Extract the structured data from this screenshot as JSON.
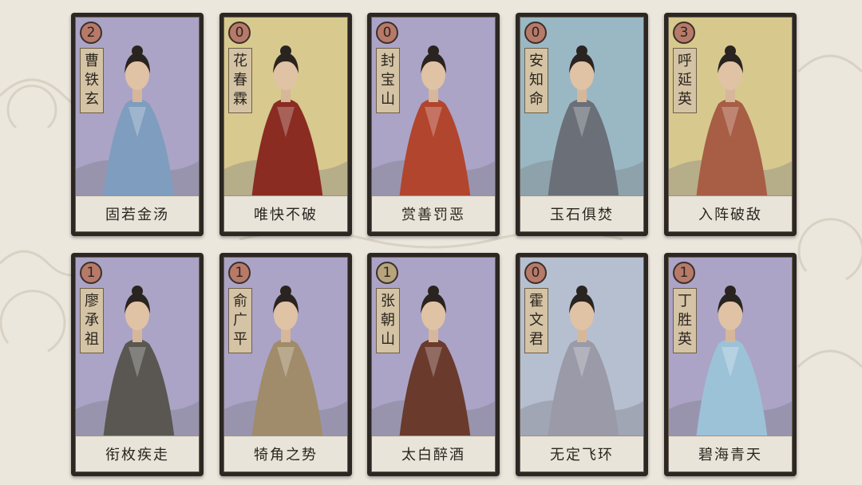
{
  "colors": {
    "background": "#ece7dd",
    "card_frame": "#2c2723",
    "cost_red": "#b77a69",
    "cost_gold": "#b7a47c",
    "name_panel": "#d4c4a5",
    "skill_bar": "#e9e4da"
  },
  "cards": [
    {
      "cost": "2",
      "name": "曹铁玄",
      "skill": "固若金汤",
      "cost_color": "#b77a69",
      "bg": "#aba4c6",
      "robe": "#7f9dbe"
    },
    {
      "cost": "0",
      "name": "花春霖",
      "skill": "唯快不破",
      "cost_color": "#b77a69",
      "bg": "#d8c98e",
      "robe": "#8a2c22"
    },
    {
      "cost": "0",
      "name": "封宝山",
      "skill": "赏善罚恶",
      "cost_color": "#b77a69",
      "bg": "#aba4c6",
      "robe": "#b2452e"
    },
    {
      "cost": "0",
      "name": "安知命",
      "skill": "玉石俱焚",
      "cost_color": "#b77a69",
      "bg": "#9ab8c4",
      "robe": "#6a6f78"
    },
    {
      "cost": "3",
      "name": "呼延英",
      "skill": "入阵破敌",
      "cost_color": "#b77a69",
      "bg": "#d7c98e",
      "robe": "#a85d45"
    },
    {
      "cost": "1",
      "name": "廖承祖",
      "skill": "衔枚疾走",
      "cost_color": "#b77a69",
      "bg": "#aba4c6",
      "robe": "#5a5752"
    },
    {
      "cost": "1",
      "name": "俞广平",
      "skill": "犄角之势",
      "cost_color": "#b77a69",
      "bg": "#aba4c6",
      "robe": "#a08c6a"
    },
    {
      "cost": "1",
      "name": "张朝山",
      "skill": "太白醉酒",
      "cost_color": "#b7a47c",
      "bg": "#aba4c6",
      "robe": "#6a3a2c"
    },
    {
      "cost": "0",
      "name": "霍文君",
      "skill": "无定飞环",
      "cost_color": "#b77a69",
      "bg": "#b5bfd0",
      "robe": "#9a9aa8"
    },
    {
      "cost": "1",
      "name": "丁胜英",
      "skill": "碧海青天",
      "cost_color": "#b77a69",
      "bg": "#aba4c6",
      "robe": "#9cc2d8"
    }
  ]
}
